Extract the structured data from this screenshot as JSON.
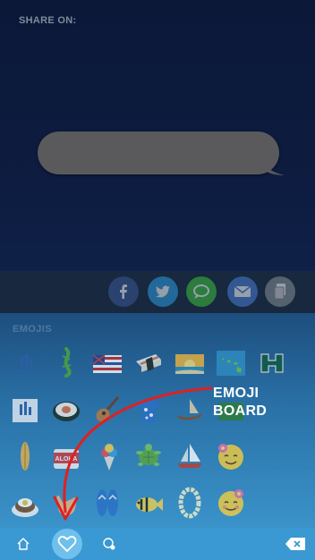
{
  "share": {
    "label": "SHARE ON:",
    "buttons": [
      "facebook-icon",
      "twitter-icon",
      "messages-icon",
      "mail-icon",
      "copy-icon"
    ]
  },
  "emoji_board": {
    "section_label": "EMOJIS",
    "can_label": "ALOHA",
    "callout_line1": "EMOJI",
    "callout_line2": "BOARD"
  },
  "tabbar": {
    "tabs": [
      "home-icon",
      "heart-icon",
      "chat-icon"
    ],
    "delete": "backspace-icon"
  },
  "colors": {
    "compose_bg": "#0d1a3d",
    "bubble": "#5a5a5c",
    "share_bg": "#17283f",
    "panel_top": "#1d4e7e",
    "panel_bottom": "#3a93c9",
    "tabbar": "#3a99d2",
    "annotation": "#e02020"
  }
}
